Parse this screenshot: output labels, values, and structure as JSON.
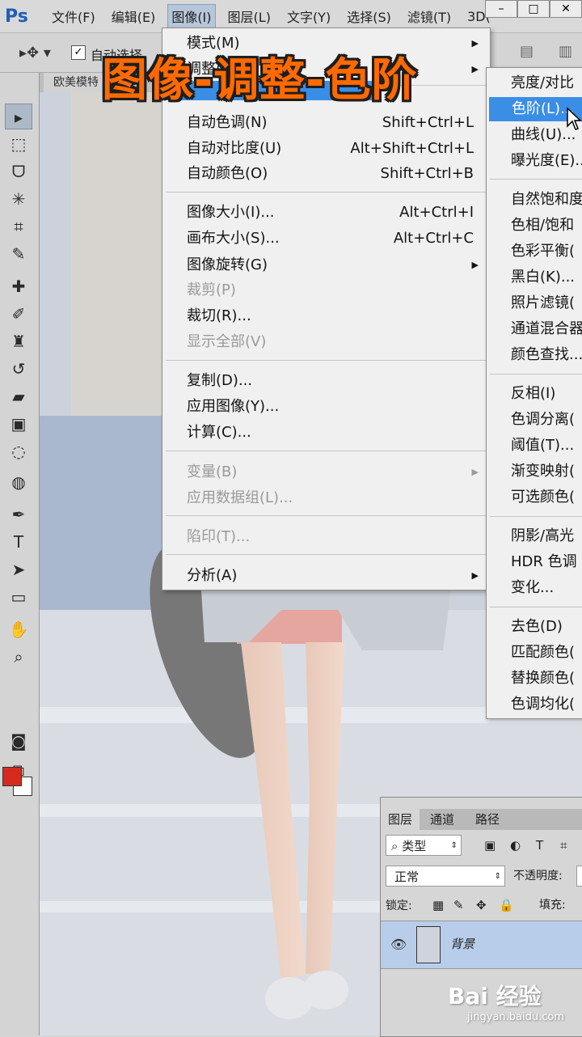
{
  "app": {
    "logo": "Ps"
  },
  "menubar": {
    "items": [
      "文件(F)",
      "编辑(E)",
      "图像(I)",
      "图层(L)",
      "文字(Y)",
      "选择(S)",
      "滤镜(T)",
      "3D("
    ],
    "active_index": 2
  },
  "window_buttons": [
    "–",
    "□",
    "✕"
  ],
  "options_bar": {
    "auto_select_label": "自动选择",
    "checked": true
  },
  "document_tab": {
    "title": "欧美模特"
  },
  "overlay_title": "图像-调整-色阶",
  "image_menu": {
    "items": [
      {
        "label": "模式(M)",
        "shortcut": "",
        "disabled": false,
        "submenu": true
      },
      {
        "label": "调整(J)",
        "shortcut": "",
        "disabled": false,
        "submenu": true
      },
      {
        "label": "自动色调(N)",
        "shortcut": "Shift+Ctrl+L",
        "disabled": false,
        "submenu": false
      },
      {
        "label": "自动对比度(U)",
        "shortcut": "Alt+Shift+Ctrl+L",
        "disabled": false,
        "submenu": false
      },
      {
        "label": "自动颜色(O)",
        "shortcut": "Shift+Ctrl+B",
        "disabled": false,
        "submenu": false
      },
      {
        "label": "图像大小(I)...",
        "shortcut": "Alt+Ctrl+I",
        "disabled": false,
        "submenu": false
      },
      {
        "label": "画布大小(S)...",
        "shortcut": "Alt+Ctrl+C",
        "disabled": false,
        "submenu": false
      },
      {
        "label": "图像旋转(G)",
        "shortcut": "",
        "disabled": false,
        "submenu": true
      },
      {
        "label": "裁剪(P)",
        "shortcut": "",
        "disabled": true,
        "submenu": false
      },
      {
        "label": "裁切(R)...",
        "shortcut": "",
        "disabled": false,
        "submenu": false
      },
      {
        "label": "显示全部(V)",
        "shortcut": "",
        "disabled": true,
        "submenu": false
      },
      {
        "label": "复制(D)...",
        "shortcut": "",
        "disabled": false,
        "submenu": false
      },
      {
        "label": "应用图像(Y)...",
        "shortcut": "",
        "disabled": false,
        "submenu": false
      },
      {
        "label": "计算(C)...",
        "shortcut": "",
        "disabled": false,
        "submenu": false
      },
      {
        "label": "变量(B)",
        "shortcut": "",
        "disabled": true,
        "submenu": true
      },
      {
        "label": "应用数据组(L)...",
        "shortcut": "",
        "disabled": true,
        "submenu": false
      },
      {
        "label": "陷印(T)...",
        "shortcut": "",
        "disabled": true,
        "submenu": false
      },
      {
        "label": "分析(A)",
        "shortcut": "",
        "disabled": false,
        "submenu": true
      }
    ]
  },
  "adjust_menu": {
    "items": [
      {
        "label": "亮度/对比",
        "highlighted": false
      },
      {
        "label": "色阶(L)...",
        "highlighted": true
      },
      {
        "label": "曲线(U)...",
        "highlighted": false
      },
      {
        "label": "曝光度(E)...",
        "highlighted": false
      },
      {
        "label": "自然饱和度",
        "highlighted": false
      },
      {
        "label": "色相/饱和",
        "highlighted": false
      },
      {
        "label": "色彩平衡(",
        "highlighted": false
      },
      {
        "label": "黑白(K)...",
        "highlighted": false
      },
      {
        "label": "照片滤镜(",
        "highlighted": false
      },
      {
        "label": "通道混合器",
        "highlighted": false
      },
      {
        "label": "颜色查找...",
        "highlighted": false
      },
      {
        "label": "反相(I)",
        "highlighted": false
      },
      {
        "label": "色调分离(",
        "highlighted": false
      },
      {
        "label": "阈值(T)...",
        "highlighted": false
      },
      {
        "label": "渐变映射(",
        "highlighted": false
      },
      {
        "label": "可选颜色(",
        "highlighted": false
      },
      {
        "label": "阴影/高光",
        "highlighted": false
      },
      {
        "label": "HDR 色调",
        "highlighted": false
      },
      {
        "label": "变化...",
        "highlighted": false
      },
      {
        "label": "去色(D)",
        "highlighted": false
      },
      {
        "label": "匹配颜色(",
        "highlighted": false
      },
      {
        "label": "替换颜色(",
        "highlighted": false
      },
      {
        "label": "色调均化(",
        "highlighted": false
      }
    ]
  },
  "layers_panel": {
    "tabs": [
      "图层",
      "通道",
      "路径"
    ],
    "filter_label": "类型",
    "blend_mode": "正常",
    "opacity_label": "不透明度:",
    "lock_label": "锁定:",
    "fill_label": "填充:",
    "layer_name": "背景"
  },
  "watermark": {
    "brand": "Bai 经验",
    "url": "jingyan.baidu.com"
  },
  "colors": {
    "foreground": "#d52b1e",
    "background": "#ffffff",
    "highlight": "#3a8ee6"
  }
}
